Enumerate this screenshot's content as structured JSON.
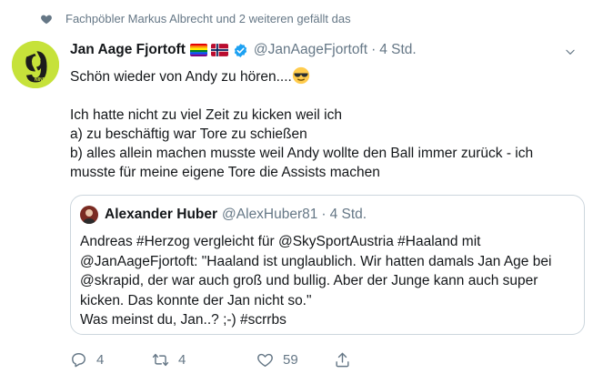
{
  "social_context": {
    "text": "Fachpöbler Markus Albrecht und 2 weiteren gefällt das",
    "icon": "heart-icon"
  },
  "tweet": {
    "author_name": "Jan Aage Fjortoft",
    "avatar_text": "9",
    "avatar_small_text": "NINE",
    "badges": [
      "rainbow-flag-icon",
      "norway-flag-icon",
      "verified-icon"
    ],
    "handle": "@JanAageFjortoft",
    "separator": "·",
    "time": "4 Std.",
    "text_line1": "Schön wieder von Andy zu hören....",
    "text_rest": "Ich hatte nicht zu viel Zeit zu kicken weil ich\na) zu beschäftig war Tore zu schießen\nb) alles allein machen musste weil Andy wollte den Ball immer zurück - ich musste für meine eigene Tore die Assists machen",
    "emoji": "sunglasses-emoji"
  },
  "quoted": {
    "author_name": "Alexander Huber",
    "handle": "@AlexHuber81",
    "separator": "·",
    "time": "4 Std.",
    "text": "Andreas #Herzog vergleicht für @SkySportAustria #Haaland mit @JanAageFjortoft: \"Haaland ist unglaublich. Wir hatten damals Jan Age bei @skrapid, der war auch groß und bullig. Aber der Junge kann auch super kicken. Das konnte der Jan nicht so.\"\nWas meinst du, Jan..?  ;-) #scrrbs"
  },
  "actions": {
    "reply_count": "4",
    "retweet_count": "4",
    "like_count": "59"
  },
  "colors": {
    "text": "#14171a",
    "secondary": "#657786",
    "accent": "#1da1f2",
    "border": "#ccd6dd",
    "avatar_bg": "#c6e23a"
  }
}
